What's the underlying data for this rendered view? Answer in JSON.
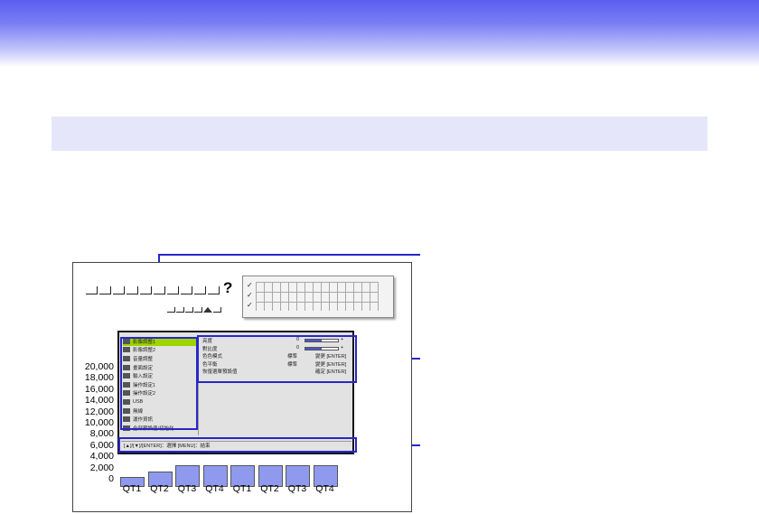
{
  "colors": {
    "header_gradient": "#5a5ef0",
    "section_bar": "#e6e6fb",
    "callout": "#2727c9",
    "bar_fill": "#8f99ee",
    "menu_selected": "#9ed400"
  },
  "slide": {
    "question_mark": "?"
  },
  "menu": {
    "left_items": [
      "影像調整1",
      "影像調整2",
      "音量調整",
      "畫面設定",
      "輸入設定",
      "操作設定1",
      "操作設定2",
      "USB",
      "無線",
      "運作資訊",
      "全部預設值/初始化"
    ],
    "right_rows": [
      {
        "label": "亮度",
        "value": "0"
      },
      {
        "label": "對比度",
        "value": "0"
      },
      {
        "label": "色色模式",
        "value": "標準",
        "action": "變更 [ENTER]"
      },
      {
        "label": "色平衡",
        "value": "標準",
        "action": "變更 [ENTER]"
      },
      {
        "label": "恢復選單預設值",
        "action": "確定 [ENTER]"
      }
    ],
    "footer": "[▲]/[▼]/[ENTER]：選擇 [MENU]：結束"
  },
  "chart_data": {
    "type": "bar",
    "categories": [
      "QT1",
      "QT2",
      "QT3",
      "QT4",
      "QT1",
      "QT2",
      "QT3",
      "QT4"
    ],
    "y_ticks": [
      "20,000",
      "18,000",
      "16,000",
      "14,000",
      "12,000",
      "10,000",
      "8,000",
      "6,000",
      "4,000",
      "2,000",
      "0"
    ],
    "values": [
      1800,
      2800,
      3800,
      3800,
      3800,
      3800,
      3800,
      3800
    ],
    "ylim": [
      0,
      20000
    ]
  }
}
